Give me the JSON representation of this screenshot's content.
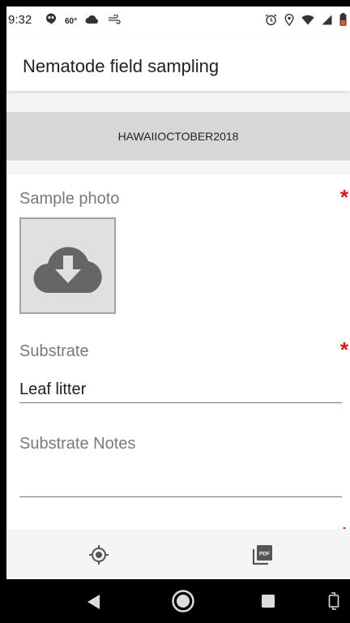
{
  "status_bar": {
    "time": "9:32",
    "temperature": "60°",
    "icons_left": [
      "hangouts-icon",
      "cloud-icon",
      "wind-icon"
    ],
    "icons_right": [
      "alarm-icon",
      "location-icon",
      "wifi-icon",
      "signal-icon",
      "battery-icon"
    ]
  },
  "app_bar": {
    "title": "Nematode field sampling"
  },
  "project": {
    "name": "HAWAIIOCTOBER2018"
  },
  "form": {
    "photo": {
      "label": "Sample photo",
      "required_mark": "*"
    },
    "substrate": {
      "label": "Substrate",
      "required_mark": "*",
      "value": "Leaf litter"
    },
    "substrate_notes": {
      "label": "Substrate Notes",
      "value": ""
    },
    "location": {
      "required_mark": "*"
    }
  },
  "toolbar": {
    "items": [
      "gps-icon",
      "pdf-icon"
    ]
  },
  "colors": {
    "required": "#e01515",
    "banner": "#d6d8d7",
    "icon_gray": "#666666"
  }
}
